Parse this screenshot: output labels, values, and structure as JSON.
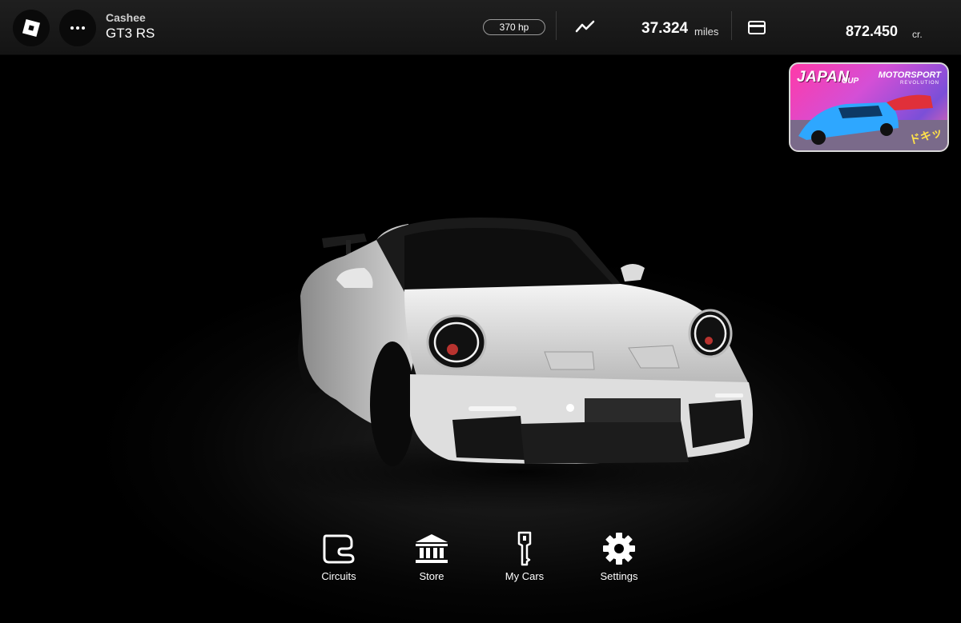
{
  "topbar": {
    "player_name": "Cashee",
    "car_name": "GT3 RS",
    "horsepower": "370 hp",
    "miles_value": "37.324",
    "miles_unit": "miles",
    "credits_value": "872.450",
    "credits_unit": "cr.",
    "icons": [
      "roblox-logo-icon",
      "more-icon",
      "trend-icon",
      "card-icon"
    ]
  },
  "promo": {
    "title": "JAPAN",
    "title_suffix": "CUP",
    "brand": "MOTORSPORT",
    "brand_sub": "REVOLUTION",
    "tag": "ドキッ"
  },
  "nav": [
    {
      "label": "Circuits",
      "icon": "circuit-icon"
    },
    {
      "label": "Store",
      "icon": "store-icon"
    },
    {
      "label": "My Cars",
      "icon": "key-icon"
    },
    {
      "label": "Settings",
      "icon": "gear-icon"
    }
  ],
  "colors": {
    "background": "#000000",
    "topbar": "#1a1a1a",
    "promo_pink": "#ff3aa8",
    "car_body": "#e8e8e8"
  }
}
